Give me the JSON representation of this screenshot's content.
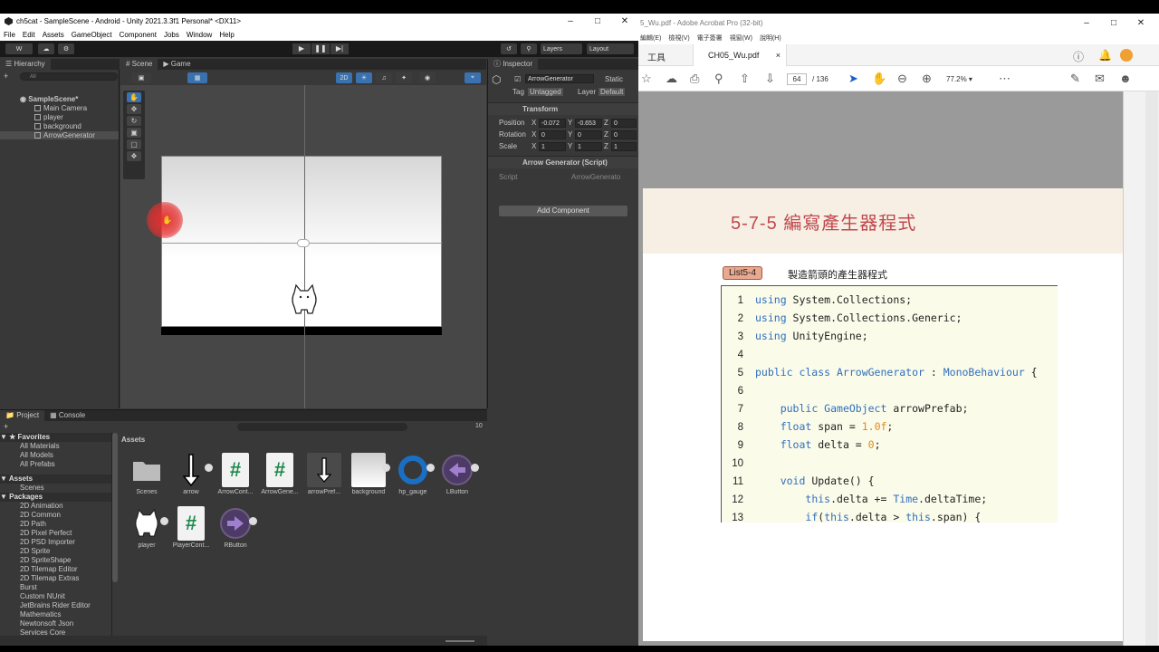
{
  "unity": {
    "title": "ch5cat - SampleScene - Android - Unity 2021.3.3f1 Personal* <DX11>",
    "menu": [
      "File",
      "Edit",
      "Assets",
      "GameObject",
      "Component",
      "Jobs",
      "Window",
      "Help"
    ],
    "toolbar": {
      "account": "W",
      "layers": "Layers",
      "layout": "Layout"
    },
    "hierarchy": {
      "tab": "Hierarchy",
      "search_placeholder": "All",
      "scene": "SampleScene*",
      "items": [
        "Main Camera",
        "player",
        "background",
        "ArrowGenerator"
      ]
    },
    "scene_tabs": {
      "scene": "Scene",
      "game": "Game",
      "mode2d": "2D"
    },
    "inspector": {
      "tab": "Inspector",
      "object_name": "ArrowGenerator",
      "static_label": "Static",
      "tag_label": "Tag",
      "tag_value": "Untagged",
      "layer_label": "Layer",
      "layer_value": "Default",
      "transform_title": "Transform",
      "position_label": "Position",
      "rotation_label": "Rotation",
      "scale_label": "Scale",
      "position": {
        "x": "-0.072",
        "y": "-0.653",
        "z": "0"
      },
      "rotation": {
        "x": "0",
        "y": "0",
        "z": "0"
      },
      "scale": {
        "x": "1",
        "y": "1",
        "z": "1"
      },
      "script_component": "Arrow Generator (Script)",
      "script_label": "Script",
      "script_value": "ArrowGenerato",
      "add_component": "Add Component"
    },
    "project": {
      "tab_project": "Project",
      "tab_console": "Console",
      "count": "10",
      "favorites": "Favorites",
      "fav_items": [
        "All Materials",
        "All Models",
        "All Prefabs"
      ],
      "assets_hdr": "Assets",
      "assets_items": [
        "Scenes"
      ],
      "packages_hdr": "Packages",
      "packages": [
        "2D Animation",
        "2D Common",
        "2D Path",
        "2D Pixel Perfect",
        "2D PSD Importer",
        "2D Sprite",
        "2D SpriteShape",
        "2D Tilemap Editor",
        "2D Tilemap Extras",
        "Burst",
        "Custom NUnit",
        "JetBrains Rider Editor",
        "Mathematics",
        "Newtonsoft Json",
        "Services Core"
      ],
      "grid_title": "Assets",
      "assets": [
        "Scenes",
        "arrow",
        "ArrowCont...",
        "ArrowGene...",
        "arrowPref...",
        "background",
        "hp_gauge",
        "LButton",
        "player",
        "PlayerCont...",
        "RButton"
      ]
    }
  },
  "acrobat": {
    "title": "5_Wu.pdf - Adobe Acrobat Pro (32-bit)",
    "menu": [
      "編輯(E)",
      "檢視(V)",
      "電子簽署",
      "視窗(W)",
      "說明(H)"
    ],
    "tools_tab": "工具",
    "doc_tab": "CH05_Wu.pdf",
    "page_current": "64",
    "page_total": "/ 136",
    "zoom": "77.2%",
    "section_title": "5-7-5 編寫產生器程式",
    "list_label": "List5-4",
    "list_caption": "製造箭頭的產生器程式",
    "code": [
      {
        "n": "1",
        "t": "using System.Collections;"
      },
      {
        "n": "2",
        "t": "using System.Collections.Generic;"
      },
      {
        "n": "3",
        "t": "using UnityEngine;"
      },
      {
        "n": "4",
        "t": ""
      },
      {
        "n": "5",
        "t": "public class ArrowGenerator : MonoBehaviour {"
      },
      {
        "n": "6",
        "t": ""
      },
      {
        "n": "7",
        "t": "    public GameObject arrowPrefab;"
      },
      {
        "n": "8",
        "t": "    float span = 1.0f;"
      },
      {
        "n": "9",
        "t": "    float delta = 0;"
      },
      {
        "n": "10",
        "t": ""
      },
      {
        "n": "11",
        "t": "    void Update() {"
      },
      {
        "n": "12",
        "t": "        this.delta += Time.deltaTime;"
      },
      {
        "n": "13",
        "t": "        if(this.delta > this.span) {"
      }
    ]
  }
}
